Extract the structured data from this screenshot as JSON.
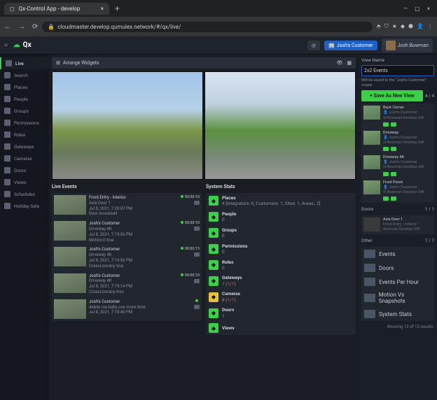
{
  "browser": {
    "tab_title": "Qx-Control App - develop",
    "url": "cloudmaster.develop.qumulex.network/#/qx/live/"
  },
  "header": {
    "app_name": "Qx",
    "customer": "Josh's Customer",
    "user": "Josh Bowman"
  },
  "sidebar": {
    "items": [
      {
        "label": "Live",
        "active": true
      },
      {
        "label": "Search"
      },
      {
        "label": "Places"
      },
      {
        "label": "People"
      },
      {
        "label": "Groups"
      },
      {
        "label": "Permissions"
      },
      {
        "label": "Roles"
      },
      {
        "label": "Gateways"
      },
      {
        "label": "Cameras"
      },
      {
        "label": "Doors"
      },
      {
        "label": "Views"
      },
      {
        "label": "Schedules"
      },
      {
        "label": "Holiday Sets"
      }
    ]
  },
  "widget_bar": {
    "label": "Arrange Widgets"
  },
  "live_events": {
    "title": "Live Events",
    "items": [
      {
        "line1": "Front Entry - Interior",
        "line2": "Axis Door 1",
        "line3": "Jul 8, 2021, 7:20:07 PM",
        "line4": "Door Accessed",
        "time": "00:00:10"
      },
      {
        "line1": "Josh's Customer",
        "line2": "Driveway 4K",
        "line3": "Jul 8, 2021, 7:19:56 PM",
        "line4": "Motion:0 true",
        "time": "00:00:10"
      },
      {
        "line1": "Josh's Customer",
        "line2": "Driveway 4K",
        "line3": "Jul 8, 2021, 7:19:56 PM",
        "line4": "CrossLine:any true",
        "time": "00:00:13"
      },
      {
        "line1": "Josh's Customer",
        "line2": "Driveway 4K",
        "line3": "Jul 8, 2021, 7:19:14 PM",
        "line4": "CrossLine:any true",
        "time": "00:00:10"
      },
      {
        "line1": "Josh's Customer",
        "line2": "delete me baby one more time",
        "line3": "Jul 8, 2021, 7:19:40 PM",
        "line4": "",
        "time": ""
      }
    ]
  },
  "system_stats": {
    "title": "System Stats",
    "items": [
      {
        "label": "Places",
        "value": "4  [Integrators: 0, Customers: 1, Sites: 1, Areas:, 2]"
      },
      {
        "label": "People",
        "value": "0"
      },
      {
        "label": "Groups",
        "value": "0"
      },
      {
        "label": "Permissions",
        "value": "0"
      },
      {
        "label": "Roles",
        "value": "0"
      },
      {
        "label": "Gateways",
        "value_html": "1 (1/1)"
      },
      {
        "label": "Cameras",
        "value_html": "8 (1/1)",
        "yellow": true
      },
      {
        "label": "Doors",
        "value": "1"
      },
      {
        "label": "Views",
        "value": ""
      }
    ]
  },
  "right_panel": {
    "view_name_label": "View Name",
    "view_name_value": "2x2 Events",
    "note": "Will be saved to the \"Josh's Customer\" scope.",
    "save_label": "+  Save As New View",
    "count": "4 / 4",
    "cameras": [
      {
        "name": "Back Corner",
        "sub1": "Josh's Customer",
        "sub2": "Bowman Develop GW"
      },
      {
        "name": "Driveway",
        "sub1": "Josh's Customer",
        "sub2": "Bowman Develop GW"
      },
      {
        "name": "Driveway 4K",
        "sub1": "Josh's Customer",
        "sub2": "Bowman Develop GW"
      },
      {
        "name": "Front Porch",
        "sub1": "Josh's Customer",
        "sub2": "Bowman Develop GW"
      }
    ],
    "doors": {
      "title": "Doors",
      "count": "1 / 1",
      "item": {
        "name": "Axis Door 1",
        "sub1": "Front Entry - Interior",
        "sub2": "Bowman Develop GW"
      }
    },
    "other": {
      "title": "Other",
      "count": "7 / 7",
      "items": [
        "Events",
        "Doors",
        "Events Per Hour",
        "Motion Vs Snapshots",
        "System Stats"
      ]
    },
    "results": "Showing 12 of 12 results."
  }
}
